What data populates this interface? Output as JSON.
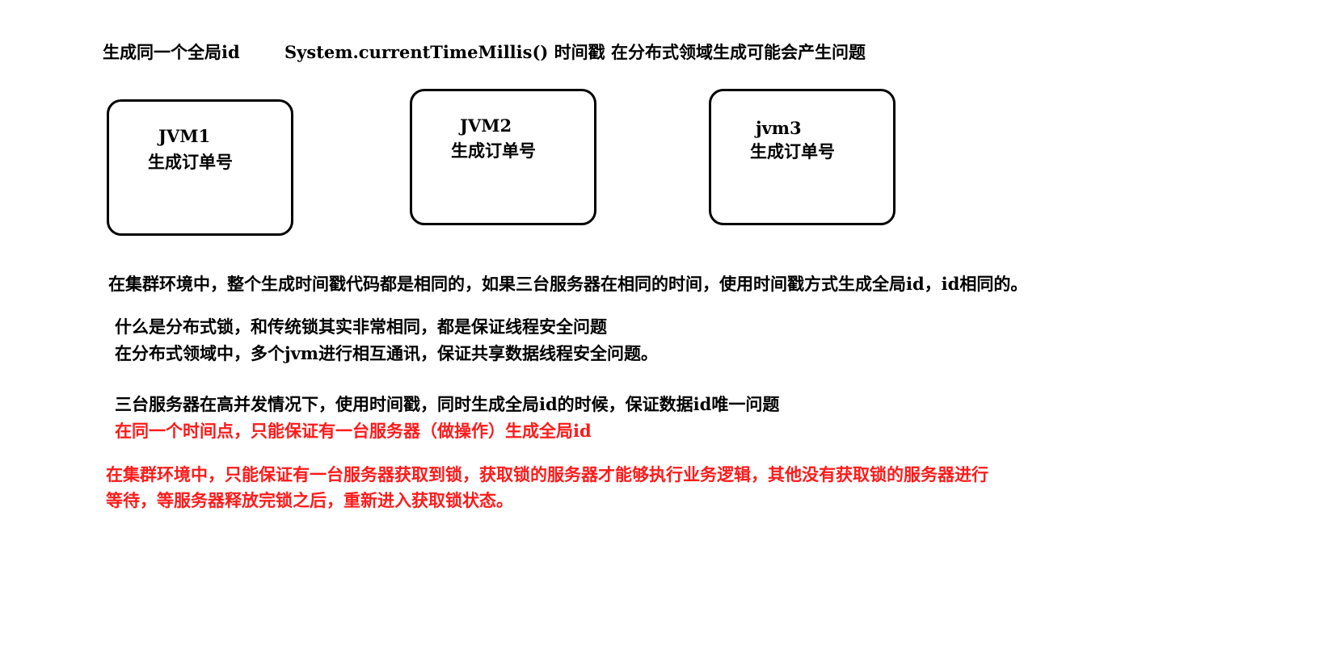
{
  "header": {
    "left": "生成同一个全局id",
    "right": "System.currentTimeMillis() 时间戳 在分布式领域生成可能会产生问题"
  },
  "boxes": [
    {
      "name": "JVM1",
      "label": "生成订单号"
    },
    {
      "name": "JVM2",
      "label": "生成订单号"
    },
    {
      "name": "jvm3",
      "label": "生成订单号"
    }
  ],
  "paragraphs": {
    "cluster_problem": "在集群环境中，整个生成时间戳代码都是相同的，如果三台服务器在相同的时间，使用时间戳方式生成全局id，id相同的。",
    "what_is_lock": "什么是分布式锁，和传统锁其实非常相同，都是保证线程安全问题",
    "distributed_domain": "在分布式领域中，多个jvm进行相互通讯，保证共享数据线程安全问题。",
    "high_concurrency": "三台服务器在高并发情况下，使用时间戳，同时生成全局id的时候，保证数据id唯一问题",
    "same_time_point": "在同一个时间点，只能保证有一台服务器（做操作）生成全局id",
    "cluster_lock_line1": "在集群环境中，只能保证有一台服务器获取到锁，获取锁的服务器才能够执行业务逻辑，其他没有获取锁的服务器进行",
    "cluster_lock_line2": "等待，等服务器释放完锁之后，重新进入获取锁状态。"
  },
  "colors": {
    "text": "#000000",
    "highlight": "#ff1a1a",
    "background": "#ffffff"
  }
}
